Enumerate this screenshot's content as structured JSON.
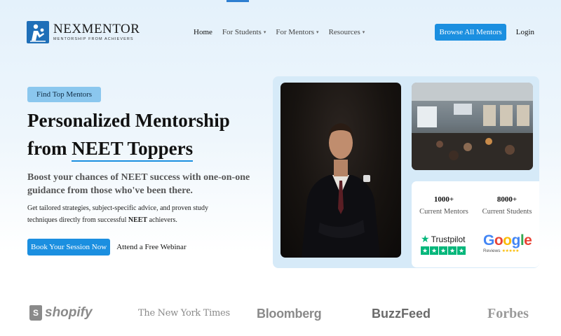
{
  "brand": {
    "name": "NEXMENTOR",
    "tagline": "MENTORSHIP FROM ACHIEVERS"
  },
  "nav": {
    "items": [
      {
        "label": "Home",
        "has_dropdown": false
      },
      {
        "label": "For Students",
        "has_dropdown": true
      },
      {
        "label": "For Mentors",
        "has_dropdown": true
      },
      {
        "label": "Resources",
        "has_dropdown": true
      }
    ],
    "browse_label": "Browse All Mentors",
    "login_label": "Login"
  },
  "hero": {
    "pill": "Find Top Mentors",
    "headline_line1": "Personalized Mentorship",
    "headline_line2_prefix": "from ",
    "headline_highlight": "NEET Toppers",
    "subhead": "Boost your chances of NEET success with one-on-one guidance from those who've been there.",
    "desc_prefix": "Get tailored strategies, subject-specific advice, and proven study techniques directly from successful ",
    "desc_bold": "NEET",
    "desc_suffix": " achievers.",
    "cta_primary": "Book Your Session Now",
    "cta_secondary": "Attend a Free Webinar"
  },
  "stats": [
    {
      "value": "1000+",
      "label": "Current Mentors"
    },
    {
      "value": "8000+",
      "label": "Current Students"
    }
  ],
  "badges": {
    "trustpilot": "Trustpilot",
    "google_word": [
      "G",
      "o",
      "o",
      "g",
      "l",
      "e"
    ],
    "google_reviews": "Reviews"
  },
  "press_logos": [
    "shopify",
    "The New York Times",
    "Bloomberg",
    "BuzzFeed",
    "Forbes"
  ],
  "colors": {
    "accent": "#1b8fe0",
    "pill_bg": "#8bc7ee",
    "panel_bg": "#d6eaf8",
    "trustpilot_green": "#00b67a"
  }
}
